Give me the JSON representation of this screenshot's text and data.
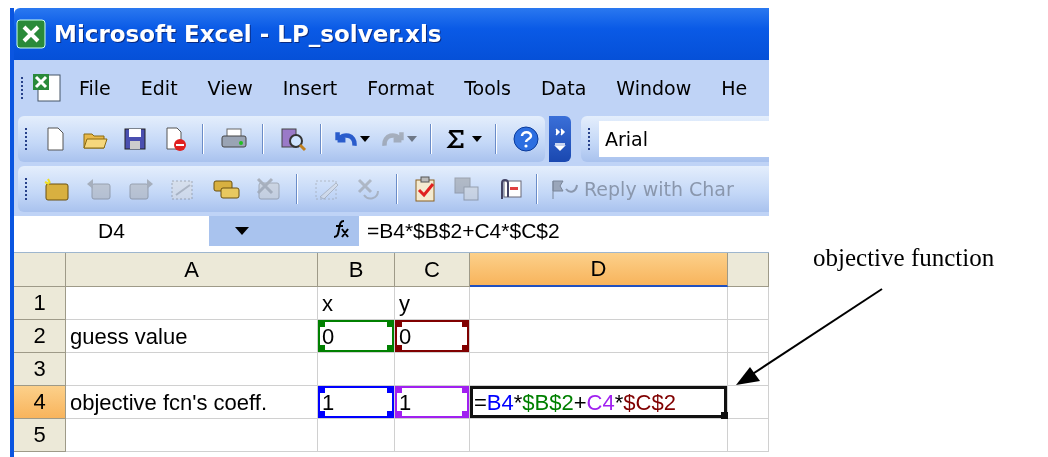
{
  "window": {
    "title": "Microsoft Excel - LP_solver.xls"
  },
  "menu": [
    "File",
    "Edit",
    "View",
    "Insert",
    "Format",
    "Tools",
    "Data",
    "Window",
    "He"
  ],
  "standard_toolbar": {
    "buttons": [
      {
        "kind": "new",
        "disabled": false
      },
      {
        "kind": "open",
        "disabled": false
      },
      {
        "kind": "save",
        "disabled": false
      },
      {
        "kind": "permission",
        "disabled": false
      },
      {
        "kind": "separator"
      },
      {
        "kind": "print",
        "disabled": false
      },
      {
        "kind": "separator"
      },
      {
        "kind": "research",
        "disabled": false
      },
      {
        "kind": "separator"
      },
      {
        "kind": "undo",
        "disabled": false
      },
      {
        "kind": "redo",
        "disabled": true
      },
      {
        "kind": "separator"
      },
      {
        "kind": "sum",
        "disabled": false
      },
      {
        "kind": "separator"
      },
      {
        "kind": "help",
        "disabled": false
      }
    ]
  },
  "font_box": {
    "value": "Arial"
  },
  "reviewing_toolbar": {
    "buttons": [
      {
        "kind": "comment",
        "disabled": false
      },
      {
        "kind": "previous",
        "disabled": true
      },
      {
        "kind": "next",
        "disabled": true
      },
      {
        "kind": "note",
        "disabled": true
      },
      {
        "kind": "comments",
        "disabled": false
      },
      {
        "kind": "delete",
        "disabled": true
      },
      {
        "kind": "separator"
      },
      {
        "kind": "ink",
        "disabled": true
      },
      {
        "kind": "erase",
        "disabled": true
      },
      {
        "kind": "separator"
      },
      {
        "kind": "track",
        "disabled": false
      },
      {
        "kind": "savedoc",
        "disabled": true
      },
      {
        "kind": "attach",
        "disabled": false
      },
      {
        "kind": "separator"
      }
    ],
    "reply": {
      "label": "Reply with Char",
      "disabled": true
    }
  },
  "formula_bar": {
    "name_box": "D4",
    "formula": "=B4*$B$2+C4*$C$2"
  },
  "sheet": {
    "columns": [
      {
        "label": "A",
        "selected": false
      },
      {
        "label": "B",
        "selected": false
      },
      {
        "label": "C",
        "selected": false
      },
      {
        "label": "D",
        "selected": true
      }
    ],
    "rows": [
      {
        "label": "1",
        "selected": false,
        "cells": [
          null,
          {
            "text": "x"
          },
          {
            "text": "y"
          },
          null
        ]
      },
      {
        "label": "2",
        "selected": false,
        "cells": [
          {
            "text": "guess value"
          },
          {
            "text": "0",
            "color": "#008000"
          },
          {
            "text": "0",
            "color": "#800000"
          },
          null
        ]
      },
      {
        "label": "3",
        "selected": false,
        "cells": [
          null,
          null,
          null,
          null
        ]
      },
      {
        "label": "4",
        "selected": true,
        "cells": [
          {
            "text": "objective fcn's coeff."
          },
          {
            "text": "1",
            "color": "#0000ff"
          },
          {
            "text": "1",
            "color": "#a020f0"
          },
          {
            "selected": true,
            "segments": [
              {
                "text": "=",
                "color": "#000000"
              },
              {
                "text": "B4",
                "color": "#0000ff"
              },
              {
                "text": "*",
                "color": "#000000"
              },
              {
                "text": "$B$2",
                "color": "#008000"
              },
              {
                "text": "+",
                "color": "#000000"
              },
              {
                "text": "C4",
                "color": "#a020f0"
              },
              {
                "text": "*",
                "color": "#000000"
              },
              {
                "text": "$C$2",
                "color": "#800000"
              }
            ]
          }
        ]
      },
      {
        "label": "5",
        "selected": false,
        "cells": [
          null,
          null,
          null,
          null
        ]
      }
    ]
  },
  "annotation": {
    "text": "objective function"
  }
}
